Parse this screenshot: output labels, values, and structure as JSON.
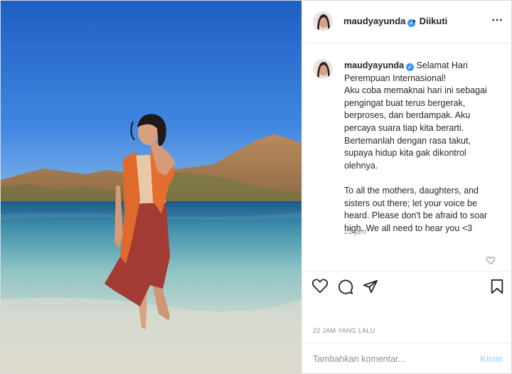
{
  "post": {
    "author": "maudyayunda",
    "follow_status": "Diikuti",
    "follow_separator": "•",
    "more_icon": "⋯",
    "caption_lines": [
      "Selamat Hari",
      "Perempuan Internasional!",
      "Aku coba memaknai hari ini sebagai",
      "pengingat buat terus bergerak,",
      "berproses, dan berdampak. Aku",
      "percaya suara tiap kita berarti.",
      "Bertemanlah dengan rasa takut,",
      "supaya hidup kita gak dikontrol",
      "olehnya.",
      "",
      "To all the mothers, daughters, and",
      "sisters out there; let your voice be",
      "heard. Please don't be afraid to soar",
      "high. We all need to hear you <3"
    ],
    "caption_time": "22 jam",
    "posted_ago": "22 JAM YANG LALU"
  },
  "comment_box": {
    "placeholder": "Tambahkan komentar...",
    "post_label": "Kirim"
  },
  "icons": {
    "like": "heart-icon",
    "comment": "comment-icon",
    "share": "paper-plane-icon",
    "save": "bookmark-icon",
    "verified": "verified-badge-icon"
  },
  "colors": {
    "verified": "#3897f0",
    "post_disabled": "#b3dbff",
    "muted": "#8e8e8e"
  }
}
